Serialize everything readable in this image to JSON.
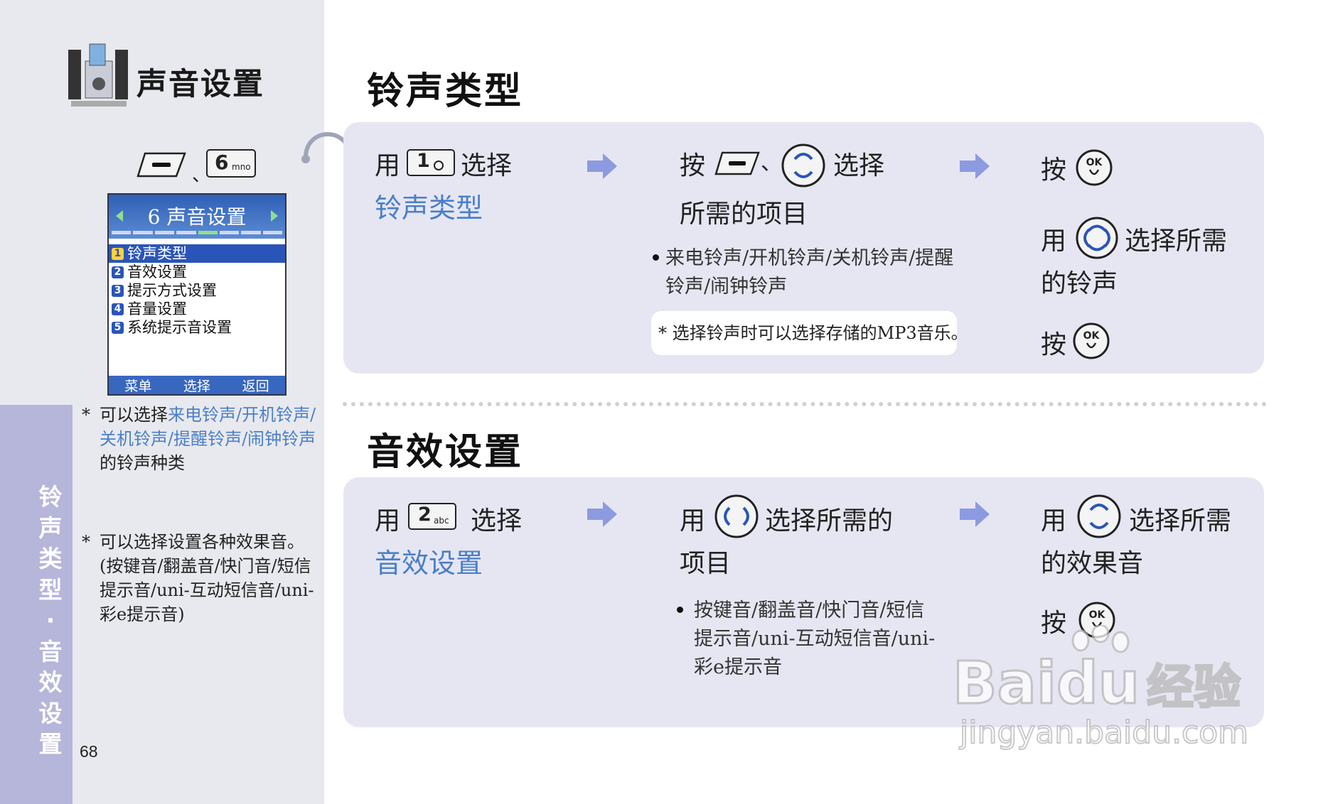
{
  "page": {
    "chapter_title": "声音设置",
    "side_tab": [
      "铃",
      "声",
      "类",
      "型",
      "·",
      "音",
      "效",
      "设",
      "置"
    ],
    "page_number": "68",
    "key_separator": "、",
    "key_six_label": "6",
    "key_six_sub": "mno"
  },
  "phone_screen": {
    "title": "6 声音设置",
    "items": [
      {
        "num": "1",
        "label": "铃声类型"
      },
      {
        "num": "2",
        "label": "音效设置"
      },
      {
        "num": "3",
        "label": "提示方式设置"
      },
      {
        "num": "4",
        "label": "音量设置"
      },
      {
        "num": "5",
        "label": "系统提示音设置"
      }
    ],
    "softkeys": [
      "菜单",
      "选择",
      "返回"
    ]
  },
  "side_notes": {
    "note1_ast": "*",
    "note1_pre": "可以选择",
    "note1_link": "来电铃声/开机铃声/关机铃声/提醒铃声/闹钟铃声",
    "note1_post": "的铃声种类",
    "note2_ast": "*",
    "note2_text": "可以选择设置各种效果音。(按键音/翻盖音/快门音/短信提示音/uni-互动短信音/uni-彩e提示音)"
  },
  "section1": {
    "title": "铃声类型",
    "step1_use": "用",
    "step1_key": "1",
    "step1_select": "选择",
    "step1_link": "铃声类型",
    "step2_press": "按",
    "step2_sep": "、",
    "step2_select": "选择",
    "step2_line2": "所需的项目",
    "step2_bullet": "来电铃声/开机铃声/关机铃声/提醒铃声/闹钟铃声",
    "step2_note": "* 选择铃声时可以选择存储的MP3音乐。",
    "step3_press": "按",
    "step3_use": "用",
    "step3_select": "选择所需",
    "step3_line2": "的铃声",
    "step3_press2": "按"
  },
  "section2": {
    "title": "音效设置",
    "step1_use": "用",
    "step1_key": "2",
    "step1_key_sub": "abc",
    "step1_select": "选择",
    "step1_link": "音效设置",
    "step2_use": "用",
    "step2_select": "选择所需的",
    "step2_line2": "项目",
    "step2_bullet": "按键音/翻盖音/快门音/短信提示音/uni-互动短信音/uni-彩e提示音",
    "step3_use": "用",
    "step3_select": "选择所需",
    "step3_line2": "的效果音",
    "step3_press": "按"
  },
  "keys": {
    "ok_label": "OK"
  },
  "watermark": {
    "brand": "Bai",
    "brand2": "du",
    "suffix": "经验",
    "url": "jingyan.baidu.com"
  }
}
